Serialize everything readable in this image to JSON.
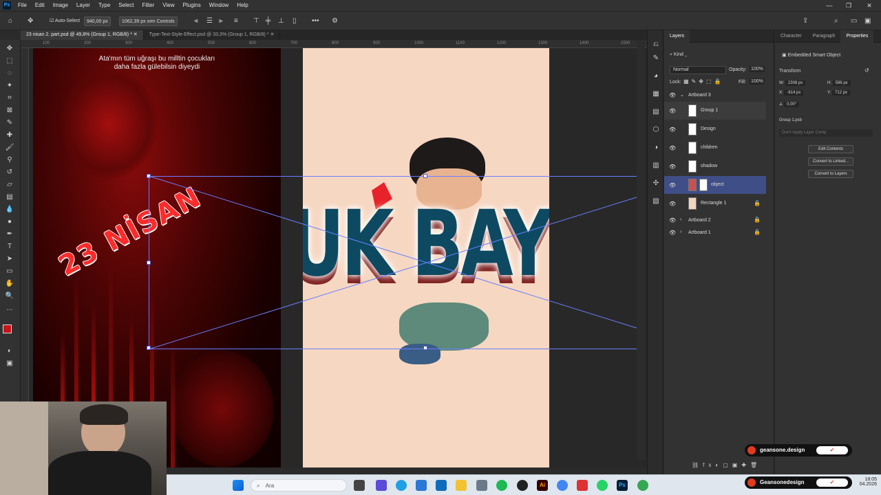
{
  "app": {
    "name": "Photoshop",
    "logo_text": "Ps"
  },
  "menubar": {
    "items": [
      "File",
      "Edit",
      "Image",
      "Layer",
      "Type",
      "Select",
      "Filter",
      "View",
      "Plugins",
      "Window",
      "Help"
    ]
  },
  "window_controls": {
    "minimize": "—",
    "restore": "❐",
    "close": "✕"
  },
  "options": {
    "auto_select_label": "Auto-Select",
    "width_value": "940,00 px",
    "transform_controls_label": "1062,39 px orm Controls"
  },
  "tabs": [
    {
      "label": "23 nisan 2. part.psd @ 49,8% (Group 1, RGB/8) *"
    },
    {
      "label": "Type-Text-Style-Effect.psd @ 33,3% (Group 1, RGB/8) *"
    }
  ],
  "ruler": {
    "ticks": [
      "100",
      "200",
      "300",
      "400",
      "500",
      "600",
      "700",
      "800",
      "900",
      "1000",
      "1100",
      "1200",
      "1300",
      "1400",
      "1500"
    ]
  },
  "canvas": {
    "quote_line1": "Ata'mın tüm uğraşı bu milltin çocukları",
    "quote_line2": "daha fazla gülebilsin diyeydi",
    "red_headline": "23 NİSAN",
    "cream_headline": "UK BAYR"
  },
  "layers_panel": {
    "tab_label": "Layers",
    "kind_label": "Kind",
    "blend_mode": "Normal",
    "opacity_label": "Opacity:",
    "opacity_value": "100%",
    "lock_label": "Lock:",
    "fill_label": "Fill:",
    "fill_value": "100%",
    "artboard3": "Artboard 3",
    "layers": [
      {
        "name": "Group 1"
      },
      {
        "name": "Design"
      },
      {
        "name": "children"
      },
      {
        "name": "shadow"
      },
      {
        "name": "object"
      },
      {
        "name": "Rectangle 1"
      }
    ],
    "artboard2": "Artboard 2",
    "artboard1": "Artboard 1"
  },
  "properties_panel": {
    "tabs": [
      "Character",
      "Paragraph",
      "Properties"
    ],
    "embedded_label": "Embedded Smart Object",
    "transform_label": "Transform",
    "w_label": "W:",
    "w_value": "2308 px",
    "h_label": "H:",
    "h_value": "596 px",
    "x_label": "X:",
    "x_value": "-614 px",
    "y_label": "Y:",
    "y_value": "712 px",
    "angle_value": "0,00°",
    "group_file": "Group 1.psb",
    "layer_comp_placeholder": "Don't Apply Layer Comp",
    "buttons": [
      "Edit Contents",
      "Convert to Linked...",
      "Convert to Layers"
    ]
  },
  "brand": {
    "label1": "geansone.design",
    "label2": "Geansonedesign"
  },
  "taskbar": {
    "search_placeholder": "Ara",
    "time": "18:05",
    "date": "04.2026"
  }
}
